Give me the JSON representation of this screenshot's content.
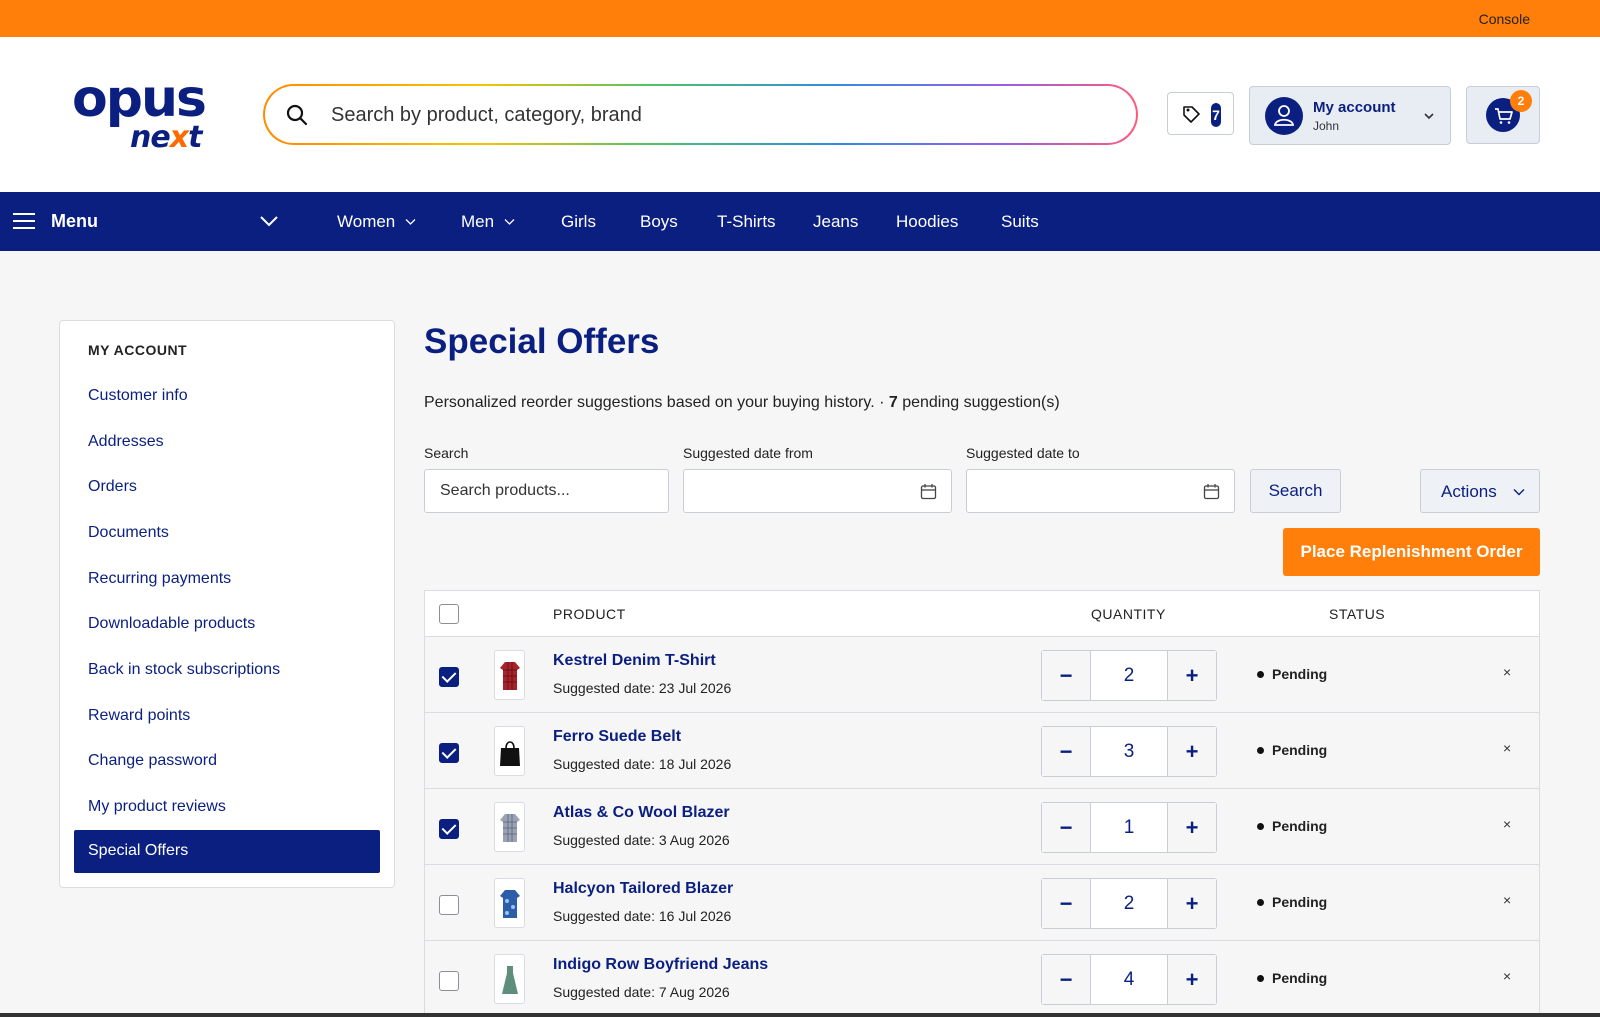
{
  "topbar": {
    "console_label": "Console"
  },
  "logo": {
    "line1": "opus",
    "line2_a": "ne",
    "line2_x": "x",
    "line2_b": "t"
  },
  "search": {
    "placeholder": "Search by product, category, brand"
  },
  "promo": {
    "count": "7"
  },
  "account": {
    "label": "My account",
    "user": "John"
  },
  "cart": {
    "count": "2"
  },
  "nav": {
    "menu_label": "Menu",
    "items": [
      {
        "label": "Women",
        "has_dropdown": true
      },
      {
        "label": "Men",
        "has_dropdown": true
      },
      {
        "label": "Girls",
        "has_dropdown": false
      },
      {
        "label": "Boys",
        "has_dropdown": false
      },
      {
        "label": "T-Shirts",
        "has_dropdown": false
      },
      {
        "label": "Jeans",
        "has_dropdown": false
      },
      {
        "label": "Hoodies",
        "has_dropdown": false
      },
      {
        "label": "Suits",
        "has_dropdown": false
      }
    ]
  },
  "sidebar": {
    "heading": "MY ACCOUNT",
    "links": [
      "Customer info",
      "Addresses",
      "Orders",
      "Documents",
      "Recurring payments",
      "Downloadable products",
      "Back in stock subscriptions",
      "Reward points",
      "Change password",
      "My product reviews"
    ],
    "active": "Special Offers"
  },
  "page": {
    "title": "Special Offers",
    "subtitle_text": "Personalized reorder suggestions based on your buying history. · ",
    "pending_count": "7",
    "pending_suffix": " pending suggestion(s)"
  },
  "filters": {
    "search_label": "Search",
    "search_placeholder": "Search products...",
    "date_from_label": "Suggested date from",
    "date_to_label": "Suggested date to",
    "search_button": "Search",
    "actions_button": "Actions",
    "order_button": "Place Replenishment Order"
  },
  "table": {
    "headers": {
      "product": "PRODUCT",
      "quantity": "QUANTITY",
      "status": "STATUS"
    },
    "rows": [
      {
        "name": "Kestrel Denim T-Shirt",
        "date": "Suggested date: 23 Jul 2026",
        "qty": "2",
        "status": "Pending",
        "checked": true,
        "thumb": "shirt-red-icon"
      },
      {
        "name": "Ferro Suede Belt",
        "date": "Suggested date: 18 Jul 2026",
        "qty": "3",
        "status": "Pending",
        "checked": true,
        "thumb": "bag-black-icon"
      },
      {
        "name": "Atlas & Co Wool Blazer",
        "date": "Suggested date: 3 Aug 2026",
        "qty": "1",
        "status": "Pending",
        "checked": true,
        "thumb": "shirt-grey-icon"
      },
      {
        "name": "Halcyon Tailored Blazer",
        "date": "Suggested date: 16 Jul 2026",
        "qty": "2",
        "status": "Pending",
        "checked": false,
        "thumb": "shirt-blue-icon"
      },
      {
        "name": "Indigo Row Boyfriend Jeans",
        "date": "Suggested date: 7 Aug 2026",
        "qty": "4",
        "status": "Pending",
        "checked": false,
        "thumb": "dress-green-icon"
      }
    ]
  },
  "colors": {
    "brand": "#0a1f80",
    "accent": "#ff7f0a"
  }
}
